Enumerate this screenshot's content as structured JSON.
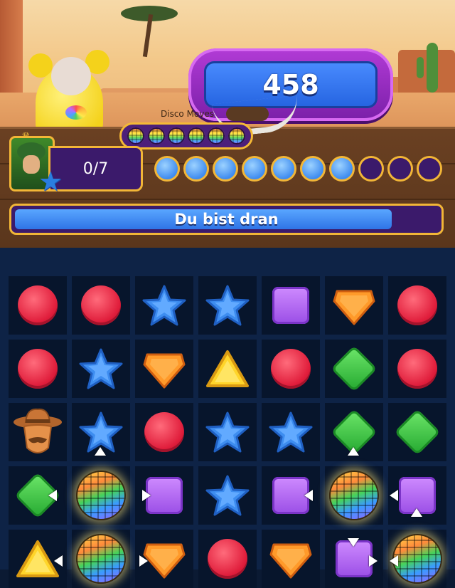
{
  "game": {
    "score": "458",
    "disco_label": "Disco Moves",
    "disco_charges": 6,
    "player_progress": "0/7",
    "moves_total": 10,
    "moves_remaining": 7,
    "turn_text": "Du bist dran",
    "turn_progress_percent": 90
  },
  "board": {
    "columns": 7,
    "visible_rows": 5,
    "rows": [
      [
        "red",
        "red",
        "blue",
        "blue",
        "purple",
        "orange",
        "red"
      ],
      [
        "red",
        "blue",
        "orange",
        "yellow",
        "red",
        "green",
        "red"
      ],
      [
        "cowboy",
        "blue",
        "red",
        "blue",
        "blue",
        "green",
        "green"
      ],
      [
        "green",
        "disco",
        "purple",
        "blue",
        "purple",
        "disco",
        "purple"
      ],
      [
        "yellow",
        "disco",
        "orange",
        "red",
        "orange",
        "purple",
        "disco"
      ]
    ]
  },
  "colors": {
    "accent_gold": "#f2b637",
    "panel_purple": "#3b1a6b",
    "score_blue": "#2463e0",
    "bar_blue": "#2f74e6"
  }
}
